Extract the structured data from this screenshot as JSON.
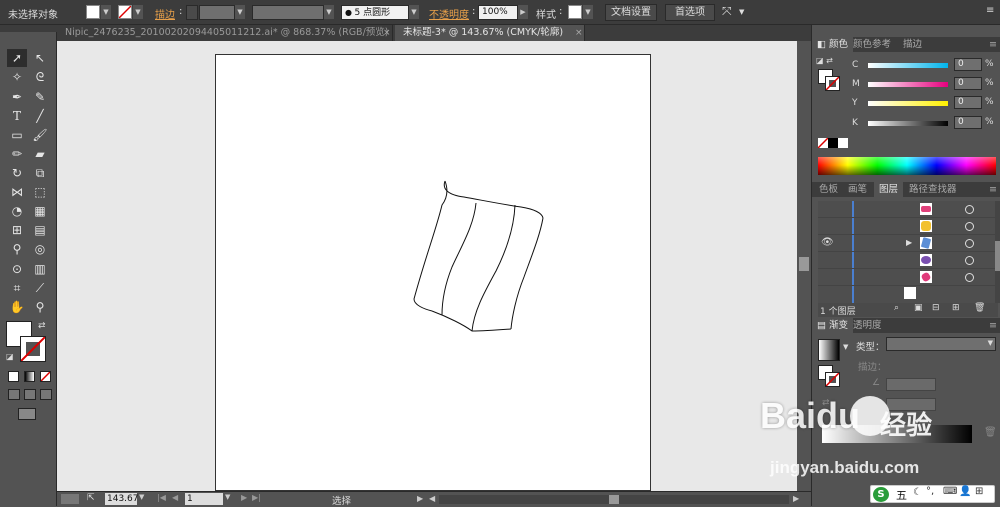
{
  "control_bar": {
    "selection_status": "未选择对象",
    "stroke_label": "描边",
    "brush_label": "5 点圆形",
    "opacity_label": "不透明度",
    "opacity_value": "100%",
    "style_label": "样式",
    "doc_setup_button": "文档设置",
    "preferences_button": "首选项"
  },
  "document_tabs": [
    {
      "label": "Nipic_2476235_20100202094405011212.ai* @ 868.37% (RGB/预览)",
      "active": false
    },
    {
      "label": "未标题-3* @ 143.67% (CMYK/轮廓)",
      "active": true
    }
  ],
  "color_panel": {
    "tabs": [
      "颜色",
      "颜色参考",
      "描边"
    ],
    "channels": [
      {
        "name": "C",
        "value": "0",
        "unit": "%"
      },
      {
        "name": "M",
        "value": "0",
        "unit": "%"
      },
      {
        "name": "Y",
        "value": "0",
        "unit": "%"
      },
      {
        "name": "K",
        "value": "0",
        "unit": "%"
      }
    ]
  },
  "layers_panel": {
    "tabs": [
      "色板",
      "画笔",
      "图层",
      "路径查找器"
    ],
    "active_tab": "图层",
    "layer_colors": [
      "#e0407a",
      "#f2c12e",
      "#5b8ed6",
      "#7a4fb0",
      "#e03a7a"
    ],
    "count_label": "1 个图层"
  },
  "gradient_panel": {
    "tabs": [
      "渐变",
      "透明度"
    ],
    "type_label": "类型：",
    "stroke_label": "描边："
  },
  "status_bar": {
    "zoom": "143.67",
    "artboard_number": "1",
    "tool_name": "选择"
  },
  "watermark": {
    "brand": "Baidu",
    "product": "经验",
    "url": "jingyan.baidu.com"
  },
  "taskbar": {
    "ime_label": "五"
  },
  "colors": {
    "panel_bg": "#535353",
    "bar_bg": "#3c3c3c",
    "canvas_bg": "#e8e8e8",
    "link_orange": "#e8a04a",
    "cyan_bar": "#00b4ec",
    "magenta_bar": "#e6007e",
    "yellow_bar": "#fff100"
  }
}
